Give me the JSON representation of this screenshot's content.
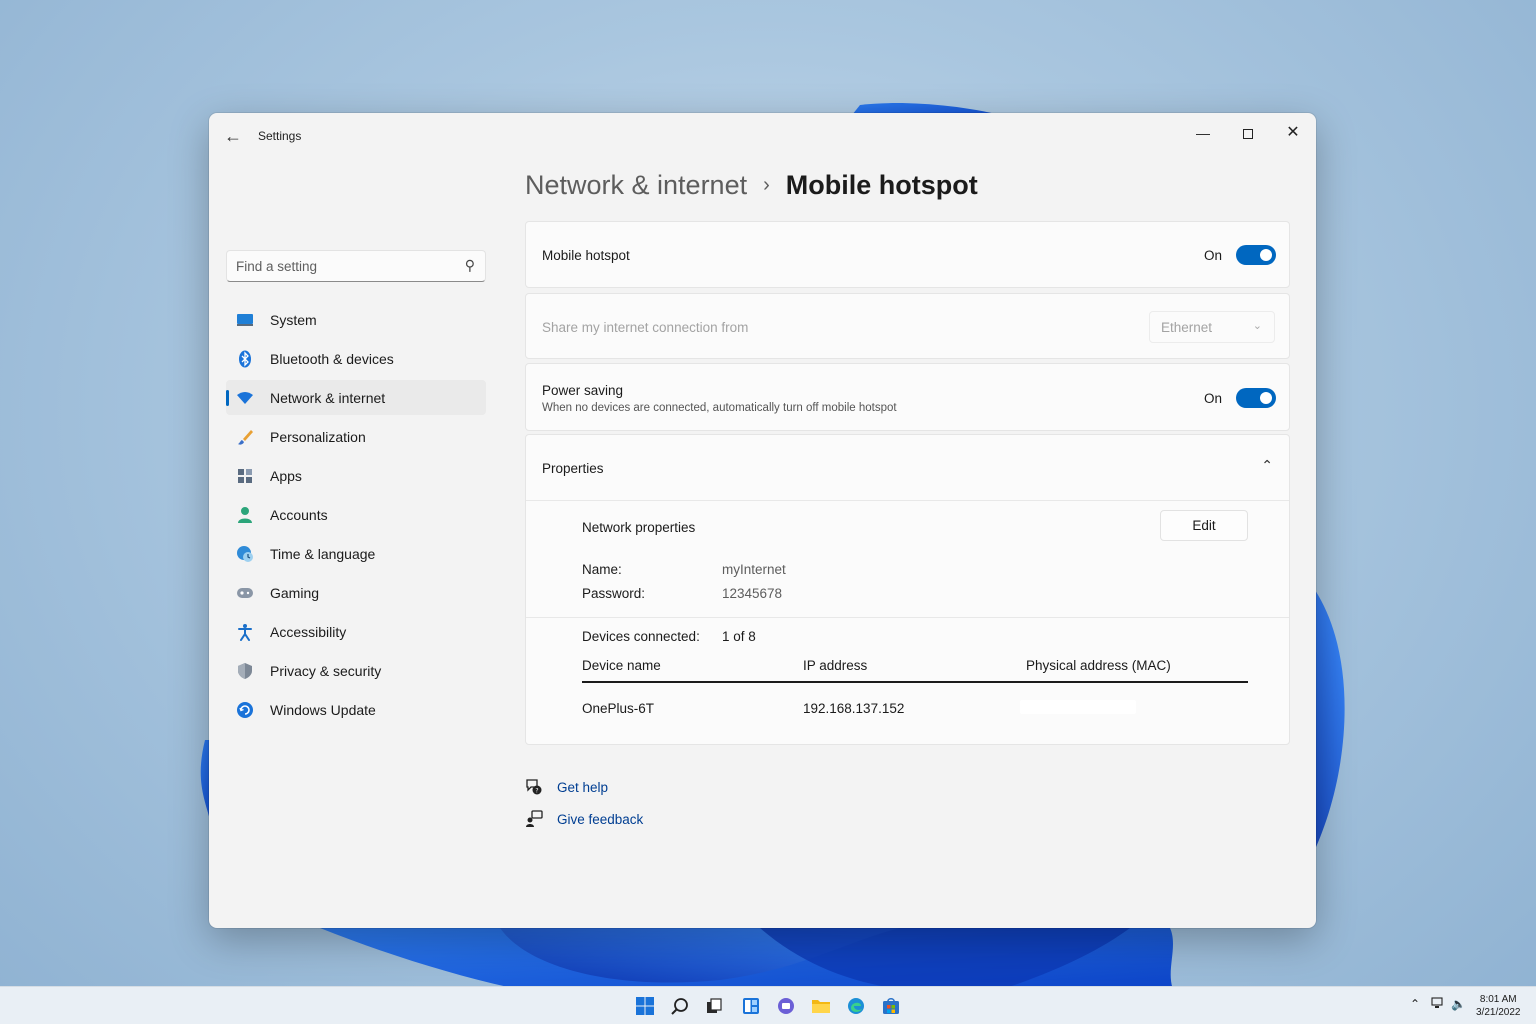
{
  "window": {
    "app_title": "Settings",
    "search_placeholder": "Find a setting"
  },
  "sidebar": {
    "items": [
      {
        "label": "System",
        "icon": "system-icon"
      },
      {
        "label": "Bluetooth & devices",
        "icon": "bluetooth-icon"
      },
      {
        "label": "Network & internet",
        "icon": "wifi-icon",
        "selected": true
      },
      {
        "label": "Personalization",
        "icon": "brush-icon"
      },
      {
        "label": "Apps",
        "icon": "apps-icon"
      },
      {
        "label": "Accounts",
        "icon": "person-icon"
      },
      {
        "label": "Time & language",
        "icon": "globe-clock-icon"
      },
      {
        "label": "Gaming",
        "icon": "gamepad-icon"
      },
      {
        "label": "Accessibility",
        "icon": "accessibility-icon"
      },
      {
        "label": "Privacy & security",
        "icon": "shield-icon"
      },
      {
        "label": "Windows Update",
        "icon": "update-icon"
      }
    ]
  },
  "breadcrumb": {
    "parent": "Network & internet",
    "separator": "›",
    "current": "Mobile hotspot"
  },
  "hotspot": {
    "label": "Mobile hotspot",
    "state": "On"
  },
  "share": {
    "label": "Share my internet connection from",
    "value": "Ethernet"
  },
  "power_saving": {
    "label": "Power saving",
    "description": "When no devices are connected, automatically turn off mobile hotspot",
    "state": "On"
  },
  "properties": {
    "label": "Properties",
    "network_properties": "Network properties",
    "edit_label": "Edit",
    "name_label": "Name:",
    "name_value": "myInternet",
    "password_label": "Password:",
    "password_value": "12345678",
    "devices_connected_label": "Devices connected:",
    "devices_connected_value": "1 of 8",
    "columns": [
      "Device name",
      "IP address",
      "Physical address (MAC)"
    ],
    "devices": [
      {
        "name": "OnePlus-6T",
        "ip": "192.168.137.152",
        "mac": ""
      }
    ]
  },
  "help": {
    "get_help": "Get help",
    "give_feedback": "Give feedback"
  },
  "taskbar": {
    "time": "8:01 AM",
    "date": "3/21/2022"
  },
  "colors": {
    "accent": "#0067c0",
    "link": "#003e92"
  }
}
